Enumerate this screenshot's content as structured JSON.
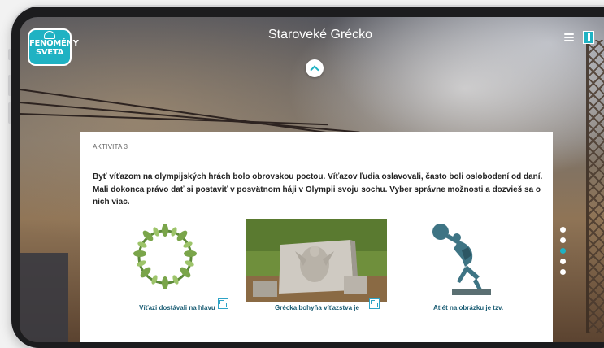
{
  "header": {
    "logo_line1": "FENOMÉNY",
    "logo_line2": "SVETA",
    "title": "Staroveké Grécko"
  },
  "activity": {
    "label": "AKTIVITA 3",
    "intro": "Byť víťazom na olympijských hrách bolo obrovskou poctou. Víťazov ľudia oslavovali, často boli oslobodení od daní. Mali dokonca právo dať si postaviť v posvätnom háji v Olympii svoju sochu. Vyber správne možnosti a dozvieš sa o nich viac."
  },
  "items": [
    {
      "caption": "Víťazi dostávali na hlavu",
      "icon": "expand-icon"
    },
    {
      "caption": "Grécka bohyňa víťazstva je",
      "icon": "expand-icon"
    },
    {
      "caption": "Atlét na obrázku je tzv.",
      "icon": "expand-icon"
    }
  ],
  "pager": {
    "count": 5,
    "active_index": 2
  },
  "colors": {
    "accent": "#1fb2c3",
    "caption": "#1b5d74",
    "card_bg": "#ffffff"
  },
  "icons": [
    "menu-icon",
    "book-icon",
    "chevron-up-icon",
    "laurel-wreath-image",
    "relief-image",
    "discobolus-statue-image"
  ]
}
